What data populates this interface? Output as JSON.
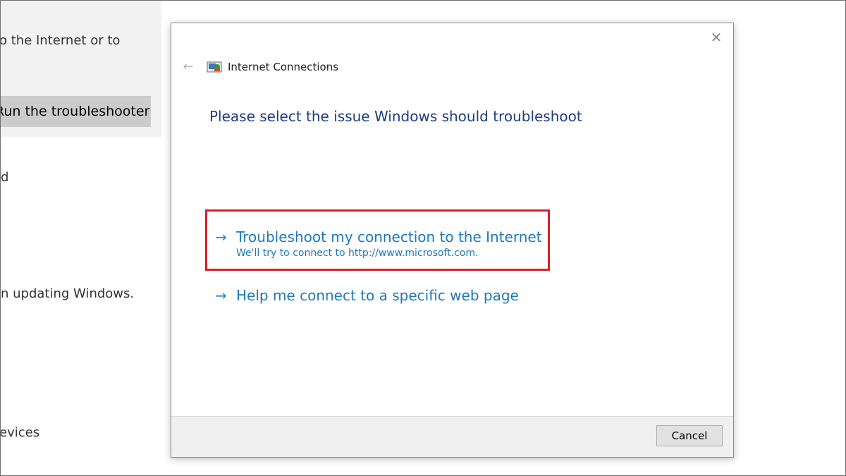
{
  "background": {
    "line1": "o the Internet or to",
    "run_button": "Run the troubleshooter",
    "line2": "d",
    "line3": "n updating Windows.",
    "line4": "evices"
  },
  "dialog": {
    "close_symbol": "✕",
    "back_symbol": "←",
    "app_title": "Internet Connections",
    "instruction": "Please select the issue Windows should troubleshoot",
    "options": [
      {
        "arrow": "→",
        "title": "Troubleshoot my connection to the Internet",
        "description": "We'll try to connect to http://www.microsoft.com."
      },
      {
        "arrow": "→",
        "title": "Help me connect to a specific web page"
      }
    ],
    "cancel_label": "Cancel"
  },
  "colors": {
    "heading_blue": "#1f3d82",
    "link_blue": "#1f78b9",
    "highlight_red": "#d3202b"
  }
}
